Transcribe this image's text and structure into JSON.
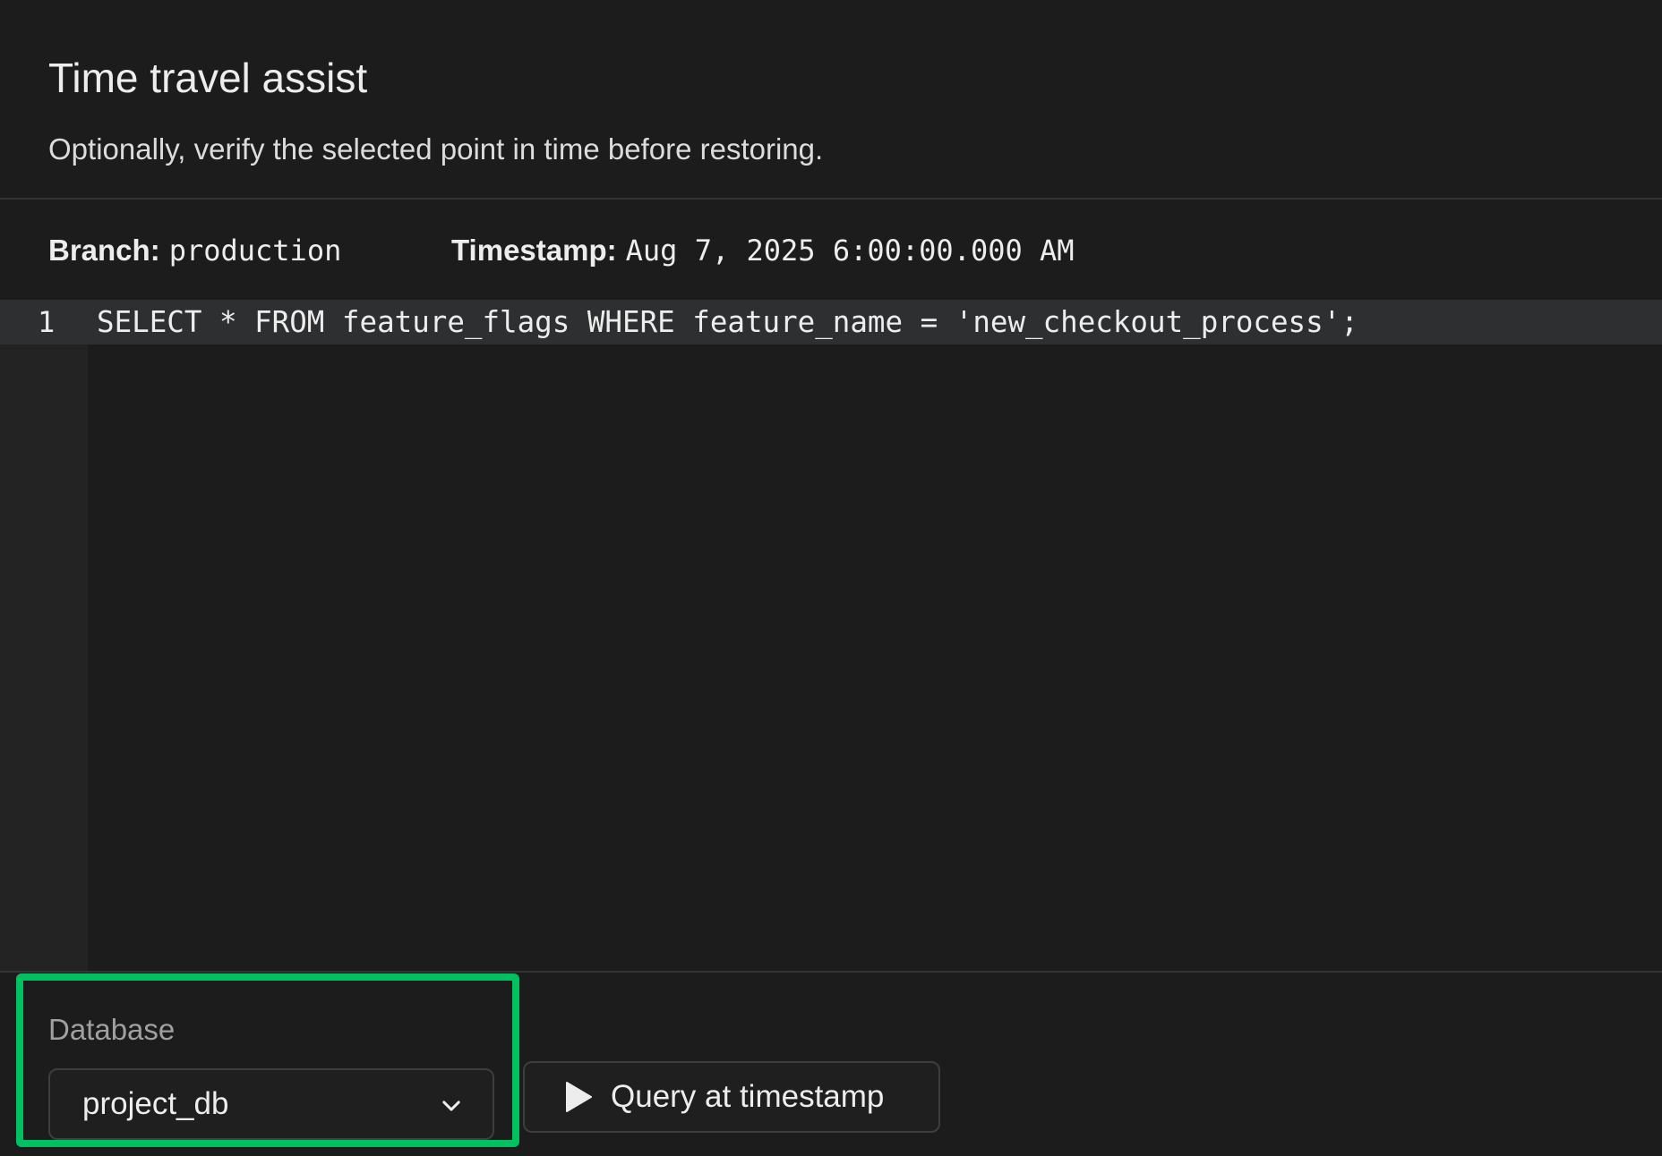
{
  "header": {
    "title": "Time travel assist",
    "subtitle": "Optionally, verify the selected point in time before restoring."
  },
  "meta": {
    "branch_label": "Branch:",
    "branch_value": "production",
    "timestamp_label": "Timestamp:",
    "timestamp_value": "Aug 7, 2025 6:00:00.000 AM"
  },
  "editor": {
    "lines": [
      {
        "number": "1",
        "code": "SELECT * FROM feature_flags WHERE feature_name = 'new_checkout_process';"
      }
    ]
  },
  "footer": {
    "database_label": "Database",
    "database_value": "project_db",
    "query_button_label": "Query at timestamp",
    "highlight_color": "#00c060"
  },
  "icons": {
    "select": "chevron-down-icon",
    "query": "play-icon"
  }
}
